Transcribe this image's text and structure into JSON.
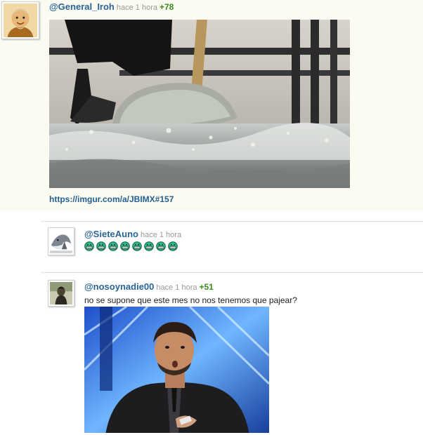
{
  "comments": [
    {
      "username": "@General_Iroh",
      "time": "hace 1 hora",
      "score": "+78",
      "link": "https://imgur.com/a/JBIMX#157",
      "avatar_icon": "iroh-avatar-icon",
      "media_icon": "shovel-water-gif-icon"
    },
    {
      "username": "@SieteAuno",
      "time": "hace 1 hora",
      "avatar_icon": "shark-avatar-icon",
      "emote_icon": "grin-emote-icon",
      "emote_count": 8
    },
    {
      "username": "@nosoynadie00",
      "time": "hace 1 hora",
      "score": "+51",
      "text": "no se supone que este mes no nos tenemos que pajear?",
      "avatar_icon": "soldier-avatar-icon",
      "media_icon": "tv-host-gif-icon"
    }
  ],
  "colors": {
    "username": "#2a6496",
    "score": "#3a8a1f",
    "time": "#999999",
    "highlight_bg": "#fbfbf1"
  }
}
